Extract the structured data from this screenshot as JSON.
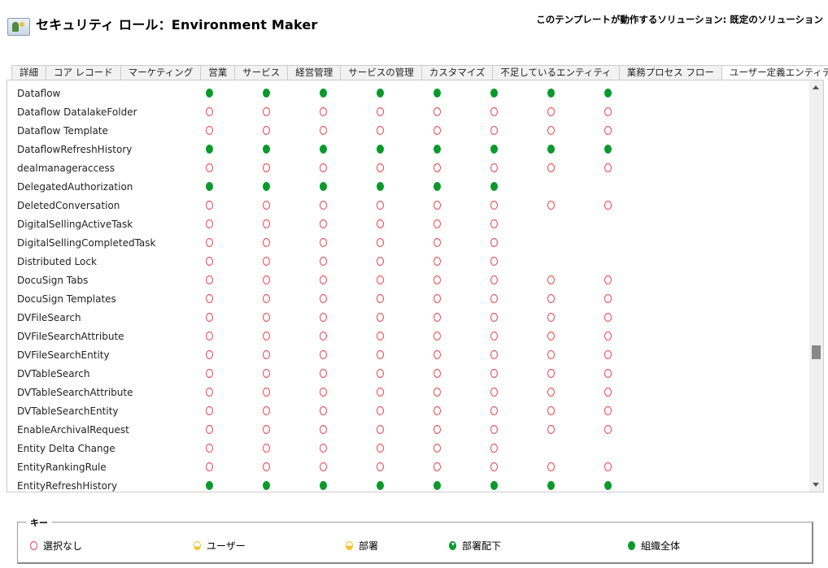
{
  "header": {
    "title": "セキュリティ ロール：Environment Maker",
    "solution": "このテンプレートが動作するソリューション: 既定のソリューション"
  },
  "tabs": [
    {
      "label": "詳細",
      "active": false
    },
    {
      "label": "コア レコード",
      "active": false
    },
    {
      "label": "マーケティング",
      "active": false
    },
    {
      "label": "営業",
      "active": false
    },
    {
      "label": "サービス",
      "active": false
    },
    {
      "label": "経営管理",
      "active": false
    },
    {
      "label": "サービスの管理",
      "active": false
    },
    {
      "label": "カスタマイズ",
      "active": false
    },
    {
      "label": "不足しているエンティティ",
      "active": false
    },
    {
      "label": "業務プロセス フロー",
      "active": false
    },
    {
      "label": "ユーザー定義エンティティ",
      "active": true
    }
  ],
  "grid": {
    "scroll_position_percent": 68,
    "rows": [
      {
        "name": "Dataflow",
        "levels": [
          "org",
          "org",
          "org",
          "org",
          "org",
          "org",
          "org",
          "org"
        ]
      },
      {
        "name": "Dataflow DatalakeFolder",
        "levels": [
          "none",
          "none",
          "none",
          "none",
          "none",
          "none",
          "none",
          "none"
        ]
      },
      {
        "name": "Dataflow Template",
        "levels": [
          "none",
          "none",
          "none",
          "none",
          "none",
          "none",
          "none",
          "none"
        ]
      },
      {
        "name": "DataflowRefreshHistory",
        "levels": [
          "org",
          "org",
          "org",
          "org",
          "org",
          "org",
          "org",
          "org"
        ]
      },
      {
        "name": "dealmanageraccess",
        "levels": [
          "none",
          "none",
          "none",
          "none",
          "none",
          "none",
          "none",
          "none"
        ]
      },
      {
        "name": "DelegatedAuthorization",
        "levels": [
          "org",
          "org",
          "org",
          "org",
          "org",
          "org",
          "",
          ""
        ]
      },
      {
        "name": "DeletedConversation",
        "levels": [
          "none",
          "none",
          "none",
          "none",
          "none",
          "none",
          "none",
          "none"
        ]
      },
      {
        "name": "DigitalSellingActiveTask",
        "levels": [
          "none",
          "none",
          "none",
          "none",
          "none",
          "none",
          "",
          ""
        ]
      },
      {
        "name": "DigitalSellingCompletedTask",
        "levels": [
          "none",
          "none",
          "none",
          "none",
          "none",
          "none",
          "",
          ""
        ]
      },
      {
        "name": "Distributed Lock",
        "levels": [
          "none",
          "none",
          "none",
          "none",
          "none",
          "none",
          "",
          ""
        ]
      },
      {
        "name": "DocuSign Tabs",
        "levels": [
          "none",
          "none",
          "none",
          "none",
          "none",
          "none",
          "none",
          "none"
        ]
      },
      {
        "name": "DocuSign Templates",
        "levels": [
          "none",
          "none",
          "none",
          "none",
          "none",
          "none",
          "none",
          "none"
        ]
      },
      {
        "name": "DVFileSearch",
        "levels": [
          "none",
          "none",
          "none",
          "none",
          "none",
          "none",
          "none",
          "none"
        ]
      },
      {
        "name": "DVFileSearchAttribute",
        "levels": [
          "none",
          "none",
          "none",
          "none",
          "none",
          "none",
          "none",
          "none"
        ]
      },
      {
        "name": "DVFileSearchEntity",
        "levels": [
          "none",
          "none",
          "none",
          "none",
          "none",
          "none",
          "none",
          "none"
        ]
      },
      {
        "name": "DVTableSearch",
        "levels": [
          "none",
          "none",
          "none",
          "none",
          "none",
          "none",
          "none",
          "none"
        ]
      },
      {
        "name": "DVTableSearchAttribute",
        "levels": [
          "none",
          "none",
          "none",
          "none",
          "none",
          "none",
          "none",
          "none"
        ]
      },
      {
        "name": "DVTableSearchEntity",
        "levels": [
          "none",
          "none",
          "none",
          "none",
          "none",
          "none",
          "none",
          "none"
        ]
      },
      {
        "name": "EnableArchivalRequest",
        "levels": [
          "none",
          "none",
          "none",
          "none",
          "none",
          "none",
          "none",
          "none"
        ]
      },
      {
        "name": "Entity Delta Change",
        "levels": [
          "none",
          "none",
          "none",
          "none",
          "none",
          "none",
          "",
          ""
        ]
      },
      {
        "name": "EntityRankingRule",
        "levels": [
          "none",
          "none",
          "none",
          "none",
          "none",
          "none",
          "none",
          "none"
        ]
      },
      {
        "name": "EntityRefreshHistory",
        "levels": [
          "org",
          "org",
          "org",
          "org",
          "org",
          "org",
          "org",
          "org"
        ]
      }
    ]
  },
  "legend": {
    "title": "キー",
    "items": [
      {
        "level": "none",
        "label": "選択なし"
      },
      {
        "level": "user",
        "label": "ユーザー"
      },
      {
        "level": "bu",
        "label": "部署"
      },
      {
        "level": "pbu",
        "label": "部署配下"
      },
      {
        "level": "org",
        "label": "組織全体"
      }
    ]
  },
  "colors": {
    "none": "#f0424b",
    "org": "#0a9a2c",
    "user": "#f3c32f"
  }
}
